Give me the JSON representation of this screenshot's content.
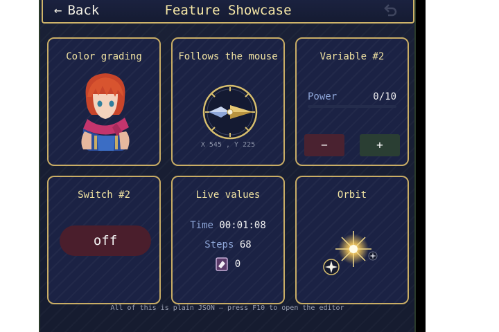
{
  "header": {
    "back_label": "Back",
    "back_arrow": "←",
    "title": "Feature Showcase",
    "undo_icon": "undo-icon"
  },
  "panels": {
    "color_grading": {
      "title": "Color grading",
      "image": "character-portrait"
    },
    "mouse": {
      "title": "Follows the mouse",
      "coords": "X 545 , Y 225",
      "icon": "compass-icon"
    },
    "variable": {
      "title": "Variable #2",
      "power_label": "Power",
      "power_value": "0/10",
      "power_fraction": 0,
      "minus_label": "−",
      "plus_label": "+"
    },
    "switch": {
      "title": "Switch #2",
      "state_label": "off"
    },
    "live": {
      "title": "Live values",
      "time_label": "Time",
      "time_value": "00:01:08",
      "steps_label": "Steps",
      "steps_value": "68",
      "item_value": "0",
      "item_icon": "item-card-icon"
    },
    "orbit": {
      "title": "Orbit",
      "icons": [
        "sun-icon",
        "star-icon"
      ]
    }
  },
  "footer": {
    "text": "All of this is plain JSON — press F10 to open the editor"
  },
  "colors": {
    "accent_gold": "#c9ad65",
    "title_text": "#f1e3a2",
    "label_blue": "#8ea6d8",
    "minus_bg": "#4a2230",
    "plus_bg": "#2a3e33",
    "switch_off": "#4a1e2c"
  }
}
